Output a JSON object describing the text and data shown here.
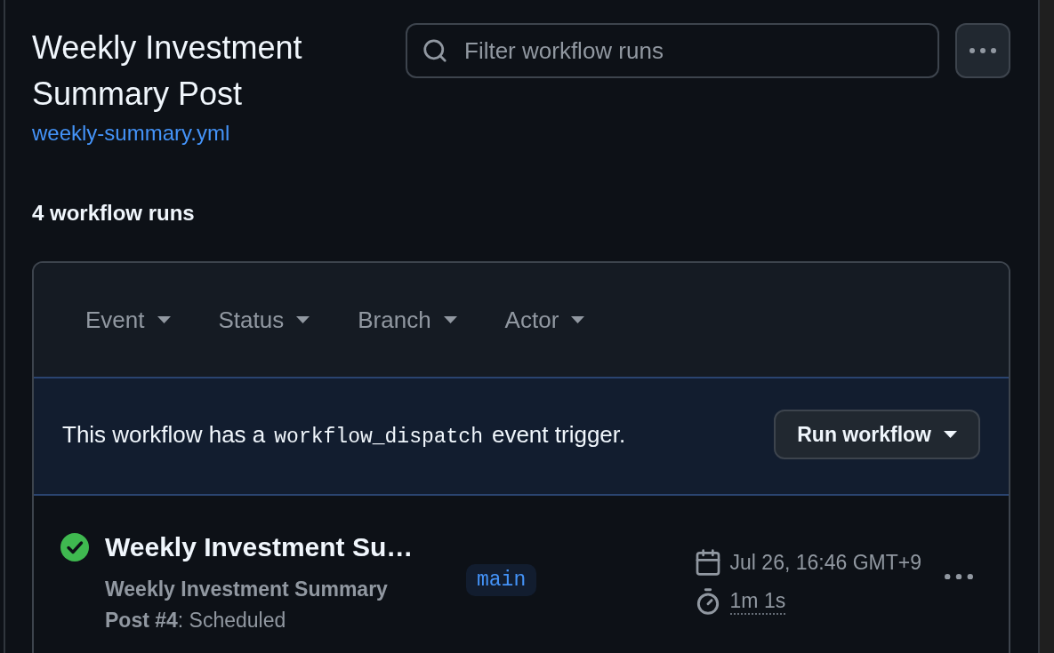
{
  "workflow": {
    "title": "Weekly Investment Summary Post",
    "file_link": "weekly-summary.yml"
  },
  "search": {
    "placeholder": "Filter workflow runs"
  },
  "run_count": "4 workflow runs",
  "filters": [
    "Event",
    "Status",
    "Branch",
    "Actor"
  ],
  "dispatch_banner": {
    "before": "This workflow has a",
    "code": "workflow_dispatch",
    "after": "event trigger.",
    "button": "Run workflow"
  },
  "runs": [
    {
      "succeeded": true,
      "title": "Weekly Investment Su…",
      "description": "**Weekly Investment Summary Post #4**: Scheduled",
      "branch": "main",
      "date": "Jul 26, 16:46 GMT+9",
      "duration": "1m 1s"
    }
  ]
}
